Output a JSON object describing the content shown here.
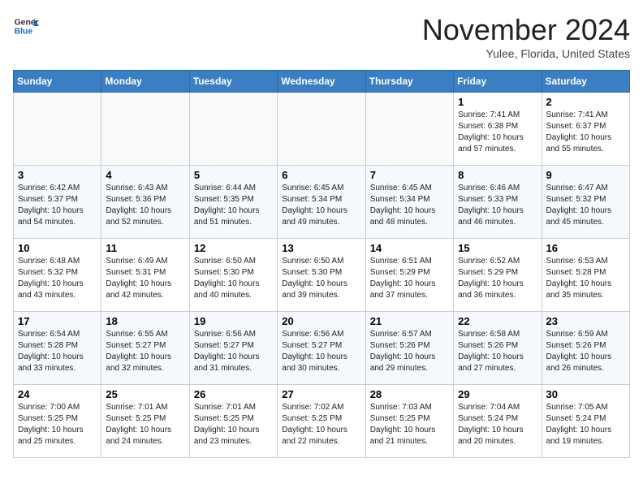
{
  "header": {
    "logo_general": "General",
    "logo_blue": "Blue",
    "month_title": "November 2024",
    "location": "Yulee, Florida, United States"
  },
  "days_of_week": [
    "Sunday",
    "Monday",
    "Tuesday",
    "Wednesday",
    "Thursday",
    "Friday",
    "Saturday"
  ],
  "weeks": [
    [
      {
        "day": "",
        "empty": true
      },
      {
        "day": "",
        "empty": true
      },
      {
        "day": "",
        "empty": true
      },
      {
        "day": "",
        "empty": true
      },
      {
        "day": "",
        "empty": true
      },
      {
        "day": "1",
        "sunrise": "Sunrise: 7:41 AM",
        "sunset": "Sunset: 6:38 PM",
        "daylight": "Daylight: 10 hours and 57 minutes."
      },
      {
        "day": "2",
        "sunrise": "Sunrise: 7:41 AM",
        "sunset": "Sunset: 6:37 PM",
        "daylight": "Daylight: 10 hours and 55 minutes."
      }
    ],
    [
      {
        "day": "3",
        "sunrise": "Sunrise: 6:42 AM",
        "sunset": "Sunset: 5:37 PM",
        "daylight": "Daylight: 10 hours and 54 minutes."
      },
      {
        "day": "4",
        "sunrise": "Sunrise: 6:43 AM",
        "sunset": "Sunset: 5:36 PM",
        "daylight": "Daylight: 10 hours and 52 minutes."
      },
      {
        "day": "5",
        "sunrise": "Sunrise: 6:44 AM",
        "sunset": "Sunset: 5:35 PM",
        "daylight": "Daylight: 10 hours and 51 minutes."
      },
      {
        "day": "6",
        "sunrise": "Sunrise: 6:45 AM",
        "sunset": "Sunset: 5:34 PM",
        "daylight": "Daylight: 10 hours and 49 minutes."
      },
      {
        "day": "7",
        "sunrise": "Sunrise: 6:45 AM",
        "sunset": "Sunset: 5:34 PM",
        "daylight": "Daylight: 10 hours and 48 minutes."
      },
      {
        "day": "8",
        "sunrise": "Sunrise: 6:46 AM",
        "sunset": "Sunset: 5:33 PM",
        "daylight": "Daylight: 10 hours and 46 minutes."
      },
      {
        "day": "9",
        "sunrise": "Sunrise: 6:47 AM",
        "sunset": "Sunset: 5:32 PM",
        "daylight": "Daylight: 10 hours and 45 minutes."
      }
    ],
    [
      {
        "day": "10",
        "sunrise": "Sunrise: 6:48 AM",
        "sunset": "Sunset: 5:32 PM",
        "daylight": "Daylight: 10 hours and 43 minutes."
      },
      {
        "day": "11",
        "sunrise": "Sunrise: 6:49 AM",
        "sunset": "Sunset: 5:31 PM",
        "daylight": "Daylight: 10 hours and 42 minutes."
      },
      {
        "day": "12",
        "sunrise": "Sunrise: 6:50 AM",
        "sunset": "Sunset: 5:30 PM",
        "daylight": "Daylight: 10 hours and 40 minutes."
      },
      {
        "day": "13",
        "sunrise": "Sunrise: 6:50 AM",
        "sunset": "Sunset: 5:30 PM",
        "daylight": "Daylight: 10 hours and 39 minutes."
      },
      {
        "day": "14",
        "sunrise": "Sunrise: 6:51 AM",
        "sunset": "Sunset: 5:29 PM",
        "daylight": "Daylight: 10 hours and 37 minutes."
      },
      {
        "day": "15",
        "sunrise": "Sunrise: 6:52 AM",
        "sunset": "Sunset: 5:29 PM",
        "daylight": "Daylight: 10 hours and 36 minutes."
      },
      {
        "day": "16",
        "sunrise": "Sunrise: 6:53 AM",
        "sunset": "Sunset: 5:28 PM",
        "daylight": "Daylight: 10 hours and 35 minutes."
      }
    ],
    [
      {
        "day": "17",
        "sunrise": "Sunrise: 6:54 AM",
        "sunset": "Sunset: 5:28 PM",
        "daylight": "Daylight: 10 hours and 33 minutes."
      },
      {
        "day": "18",
        "sunrise": "Sunrise: 6:55 AM",
        "sunset": "Sunset: 5:27 PM",
        "daylight": "Daylight: 10 hours and 32 minutes."
      },
      {
        "day": "19",
        "sunrise": "Sunrise: 6:56 AM",
        "sunset": "Sunset: 5:27 PM",
        "daylight": "Daylight: 10 hours and 31 minutes."
      },
      {
        "day": "20",
        "sunrise": "Sunrise: 6:56 AM",
        "sunset": "Sunset: 5:27 PM",
        "daylight": "Daylight: 10 hours and 30 minutes."
      },
      {
        "day": "21",
        "sunrise": "Sunrise: 6:57 AM",
        "sunset": "Sunset: 5:26 PM",
        "daylight": "Daylight: 10 hours and 29 minutes."
      },
      {
        "day": "22",
        "sunrise": "Sunrise: 6:58 AM",
        "sunset": "Sunset: 5:26 PM",
        "daylight": "Daylight: 10 hours and 27 minutes."
      },
      {
        "day": "23",
        "sunrise": "Sunrise: 6:59 AM",
        "sunset": "Sunset: 5:26 PM",
        "daylight": "Daylight: 10 hours and 26 minutes."
      }
    ],
    [
      {
        "day": "24",
        "sunrise": "Sunrise: 7:00 AM",
        "sunset": "Sunset: 5:25 PM",
        "daylight": "Daylight: 10 hours and 25 minutes."
      },
      {
        "day": "25",
        "sunrise": "Sunrise: 7:01 AM",
        "sunset": "Sunset: 5:25 PM",
        "daylight": "Daylight: 10 hours and 24 minutes."
      },
      {
        "day": "26",
        "sunrise": "Sunrise: 7:01 AM",
        "sunset": "Sunset: 5:25 PM",
        "daylight": "Daylight: 10 hours and 23 minutes."
      },
      {
        "day": "27",
        "sunrise": "Sunrise: 7:02 AM",
        "sunset": "Sunset: 5:25 PM",
        "daylight": "Daylight: 10 hours and 22 minutes."
      },
      {
        "day": "28",
        "sunrise": "Sunrise: 7:03 AM",
        "sunset": "Sunset: 5:25 PM",
        "daylight": "Daylight: 10 hours and 21 minutes."
      },
      {
        "day": "29",
        "sunrise": "Sunrise: 7:04 AM",
        "sunset": "Sunset: 5:24 PM",
        "daylight": "Daylight: 10 hours and 20 minutes."
      },
      {
        "day": "30",
        "sunrise": "Sunrise: 7:05 AM",
        "sunset": "Sunset: 5:24 PM",
        "daylight": "Daylight: 10 hours and 19 minutes."
      }
    ]
  ]
}
